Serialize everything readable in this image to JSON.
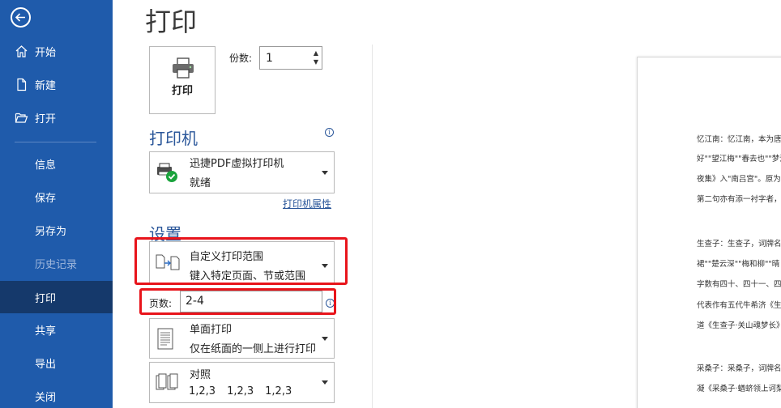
{
  "title": "打印",
  "sidebar": {
    "items": [
      {
        "label": "开始"
      },
      {
        "label": "新建"
      },
      {
        "label": "打开"
      },
      {
        "label": "信息"
      },
      {
        "label": "保存"
      },
      {
        "label": "另存为"
      },
      {
        "label": "历史记录"
      },
      {
        "label": "打印"
      },
      {
        "label": "共享"
      },
      {
        "label": "导出"
      },
      {
        "label": "关闭"
      }
    ]
  },
  "print_button": {
    "label": "打印"
  },
  "copies": {
    "label": "份数:",
    "value": "1"
  },
  "printer": {
    "section_title": "打印机",
    "name": "迅捷PDF虚拟打印机",
    "status": "就绪",
    "properties_link": "打印机属性"
  },
  "settings": {
    "section_title": "设置",
    "range": {
      "title": "自定义打印范围",
      "desc": "键入特定页面、节或范围"
    },
    "pages": {
      "label": "页数:",
      "value": "2-4"
    },
    "sides": {
      "title": "单面打印",
      "desc": "仅在纸面的一侧上进行打印"
    },
    "collate": {
      "title": "对照",
      "nums": [
        "1,2,3",
        "1,2,3",
        "1,2,3"
      ]
    }
  },
  "preview": {
    "lines": [
      "忆江南：忆江南，本为唐",
      "好\"\"望江梅\"\"春去也\"\"梦江",
      "夜集》入\"南吕宫\"。原为",
      "第二句亦有添一衬字者，",
      "生查子：生查子，词牌名",
      "裙\"\"楚云深\"\"梅和柳\"\"晴",
      "字数有四十、四十一、四",
      "代表作有五代牛希济《生",
      "道《生查子·关山魂梦长》",
      "采桑子：采桑子，词牌名",
      "凝《采桑子·蝤蛴领上诃梨"
    ]
  }
}
